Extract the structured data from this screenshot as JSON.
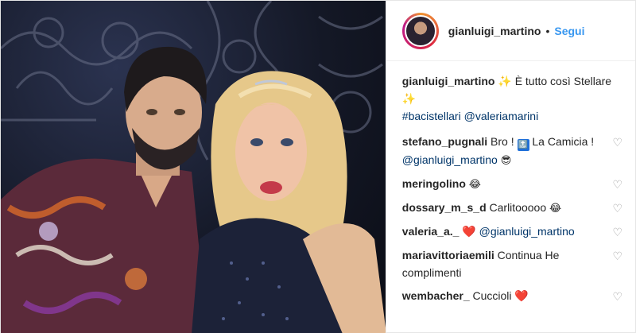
{
  "header": {
    "username": "gianluigi_martino",
    "separator": "•",
    "follow_label": "Segui"
  },
  "caption": {
    "username": "gianluigi_martino",
    "sparkle_left": "✨",
    "text": "È tutto così Stellare",
    "sparkle_right": "✨",
    "hashtag": "#bacistellari",
    "mention": "@valeriamarini"
  },
  "comments": [
    {
      "username": "stefano_pugnali",
      "text": "Bro !",
      "badge": "🔝",
      "text2": "La Camicia !",
      "mention": "@gianluigi_martino",
      "emoji": "😎"
    },
    {
      "username": "meringolino",
      "emoji": "😂"
    },
    {
      "username": "dossary_m_s_d",
      "text": "Carlitooooo",
      "emoji": "😂"
    },
    {
      "username": "valeria_a._",
      "emoji": "❤️",
      "mention": "@gianluigi_martino"
    },
    {
      "username": "mariavittoriaemili",
      "text": "Continua He complimenti"
    },
    {
      "username": "wembacher_",
      "text": "Cuccioli",
      "emoji": "❤️"
    }
  ],
  "icons": {
    "heart": "heart-outline-icon"
  },
  "colors": {
    "follow": "#3897f0",
    "mention": "#003569",
    "heart_red": "#ed4956"
  }
}
